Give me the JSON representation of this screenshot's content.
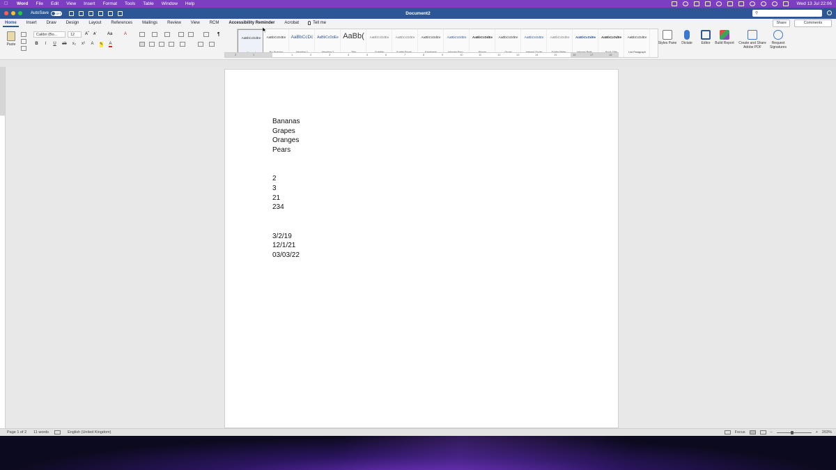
{
  "menubar": {
    "app": "Word",
    "items": [
      "File",
      "Edit",
      "View",
      "Insert",
      "Format",
      "Tools",
      "Table",
      "Window",
      "Help"
    ],
    "clock": "Wed 13 Jul  22:06"
  },
  "titlebar": {
    "autosave_label": "AutoSave",
    "autosave_state": "OFF",
    "doc_title": "Document2",
    "search_placeholder": ""
  },
  "ribbon_tabs": {
    "tabs": [
      "Home",
      "Insert",
      "Draw",
      "Design",
      "Layout",
      "References",
      "Mailings",
      "Review",
      "View",
      "RCM",
      "Accessibility Reminder",
      "Acrobat"
    ],
    "tell_me": "Tell me",
    "share": "Share",
    "comments": "Comments"
  },
  "ribbon": {
    "paste_label": "Paste",
    "font_name": "Calibri (Bo...",
    "font_size": "12",
    "styles": [
      {
        "sample": "AaBbCcDdEe",
        "name": "Normal"
      },
      {
        "sample": "AaBbCcDdEe",
        "name": "No Spacing"
      },
      {
        "sample": "AaBbCcDc",
        "name": "Heading 1"
      },
      {
        "sample": "AaBbCcDdEe",
        "name": "Heading 2"
      },
      {
        "sample": "AaBb(",
        "name": "Title"
      },
      {
        "sample": "AaBbCcDdEe",
        "name": "Subtitle"
      },
      {
        "sample": "AaBbCcDdEe",
        "name": "Subtle Emph..."
      },
      {
        "sample": "AaBbCcDdEe",
        "name": "Emphasis"
      },
      {
        "sample": "AaBbCcDdEe",
        "name": "Intense Emp..."
      },
      {
        "sample": "AaBbCcDdEe",
        "name": "Strong"
      },
      {
        "sample": "AaBbCcDdEe",
        "name": "Quote"
      },
      {
        "sample": "AaBbCcDdEe",
        "name": "Intense Quote"
      },
      {
        "sample": "AaBbCcDdEe",
        "name": "Subtle Refer..."
      },
      {
        "sample": "AaBbCcDdEe",
        "name": "Intense Refe..."
      },
      {
        "sample": "AaBbCcDdEe",
        "name": "Book Title"
      },
      {
        "sample": "AaBbCcDdEe",
        "name": "List Paragraph"
      }
    ],
    "styles_pane": "Styles Pane",
    "dictate": "Dictate",
    "editor": "Editor",
    "build_report": "Build Report",
    "create_share_pdf": "Create and Share Adobe PDF",
    "request_signatures": "Request Signatures"
  },
  "ruler": {
    "numbers": [
      "2",
      "1",
      "1",
      "2",
      "3",
      "4",
      "5",
      "6",
      "7",
      "8",
      "9",
      "10",
      "11",
      "12",
      "13",
      "14",
      "15",
      "16",
      "17",
      "18"
    ]
  },
  "document": {
    "fruits": [
      "Bananas",
      "Grapes",
      "Oranges",
      "Pears"
    ],
    "numbers": [
      "2",
      "3",
      "21",
      "234"
    ],
    "dates": [
      "3/2/19",
      "12/1/21",
      "03/03/22"
    ]
  },
  "statusbar": {
    "page": "Page 1 of 2",
    "words": "11 words",
    "language": "English (United Kingdom)",
    "focus": "Focus",
    "zoom": "203%"
  },
  "colors": {
    "menubar": "#7d3fc1",
    "titlebar": "#2b5797",
    "accent": "#2b5797"
  }
}
